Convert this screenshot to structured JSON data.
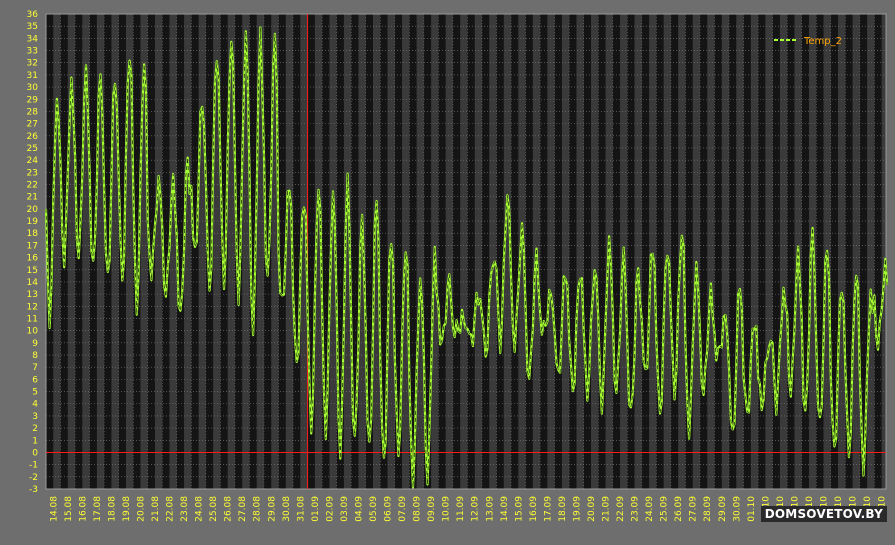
{
  "watermark": "DOMSOVETOV.BY",
  "colors": {
    "background": "#6e6e6e",
    "plot_bg": "#141414",
    "stripe": "#3a3a3a",
    "grid": "#7a7a7a",
    "series": "#a6ff33",
    "tick_text": "#ffff33",
    "legend_text": "#ffa500",
    "marker": "#ff1a1a"
  },
  "chart_data": {
    "type": "line",
    "title": "",
    "xlabel": "",
    "ylabel": "",
    "ylim": [
      -3,
      36
    ],
    "yticks": [
      -3,
      -2,
      -1,
      0,
      1,
      2,
      3,
      4,
      5,
      6,
      7,
      8,
      9,
      10,
      11,
      12,
      13,
      14,
      15,
      16,
      17,
      18,
      19,
      20,
      21,
      22,
      23,
      24,
      25,
      26,
      27,
      28,
      29,
      30,
      31,
      32,
      33,
      34,
      35,
      36
    ],
    "categories": [
      "14.08",
      "15.08",
      "16.08",
      "17.08",
      "18.08",
      "19.08",
      "20.08",
      "21.08",
      "22.08",
      "23.08",
      "24.08",
      "25.08",
      "26.08",
      "27.08",
      "28.08",
      "29.08",
      "30.08",
      "31.08",
      "01.09",
      "02.09",
      "03.09",
      "04.09",
      "05.09",
      "06.09",
      "07.09",
      "08.09",
      "09.09",
      "10.09",
      "11.09",
      "12.09",
      "13.09",
      "14.09",
      "15.09",
      "16.09",
      "17.09",
      "18.09",
      "19.09",
      "20.09",
      "21.09",
      "22.09",
      "23.09",
      "24.09",
      "25.09",
      "26.09",
      "27.09",
      "28.09",
      "29.09",
      "30.09",
      "01.10",
      "02.10",
      "03.10",
      "04.10",
      "05.10",
      "06.10",
      "07.10",
      "08.10",
      "09.10",
      "10.10"
    ],
    "grid": true,
    "legend_position": "top-right",
    "vertical_marker": "01.09",
    "horizontal_marker": 0,
    "series": [
      {
        "name": "Temp_2",
        "style": "dashed",
        "daily_min": [
          11,
          16,
          16,
          15,
          14,
          14,
          12,
          15,
          13,
          11,
          16,
          13,
          14,
          13,
          10,
          14,
          12,
          7,
          2,
          2,
          0,
          1,
          0,
          -1,
          0,
          -2,
          -2,
          9,
          10,
          9,
          8,
          9,
          9,
          6,
          10,
          6,
          5,
          5,
          4,
          5,
          3,
          6,
          3,
          5,
          2,
          5,
          8,
          1,
          3,
          4,
          4,
          5,
          3,
          2,
          0,
          0,
          -1,
          9
        ],
        "daily_max": [
          29,
          30,
          31,
          31,
          31,
          33,
          32,
          22,
          22,
          24,
          29,
          33,
          34,
          34,
          34,
          34,
          22,
          21,
          22,
          21,
          22,
          19,
          21,
          18,
          17,
          14,
          16,
          14,
          11,
          13,
          16,
          21,
          18,
          16,
          13,
          15,
          15,
          15,
          17,
          16,
          15,
          17,
          17,
          18,
          15,
          13,
          11,
          14,
          11,
          9,
          13,
          16,
          18,
          17,
          14,
          15,
          13,
          15
        ]
      }
    ]
  }
}
